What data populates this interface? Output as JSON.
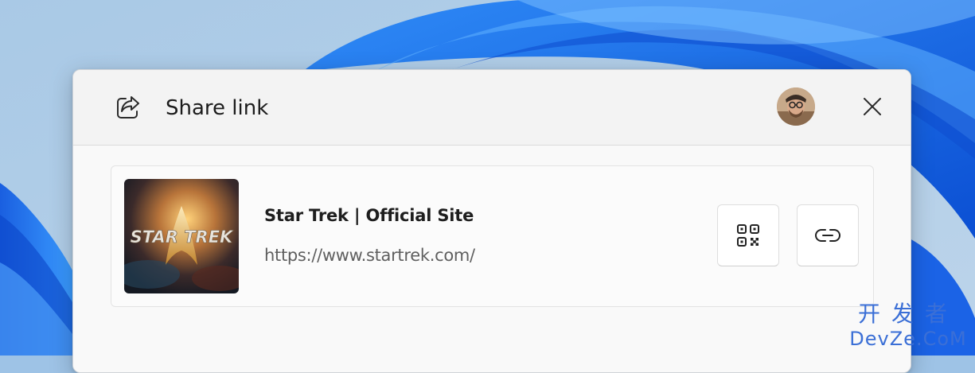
{
  "dialog": {
    "title": "Share link",
    "share_icon": "share-icon",
    "avatar": "user-avatar",
    "close_icon": "close-icon"
  },
  "card": {
    "thumbnail_text": "STAR TREK",
    "title": "Star Trek | Official Site",
    "url": "https://www.startrek.com/",
    "qr_icon": "qr-code-icon",
    "copy_icon": "link-icon"
  },
  "watermark": {
    "cn": "开发者",
    "en": "DevZe.CoM"
  },
  "colors": {
    "wallpaper_blue": "#1e6fe8",
    "dialog_bg": "#f3f3f3",
    "watermark": "#3b6fd6"
  }
}
